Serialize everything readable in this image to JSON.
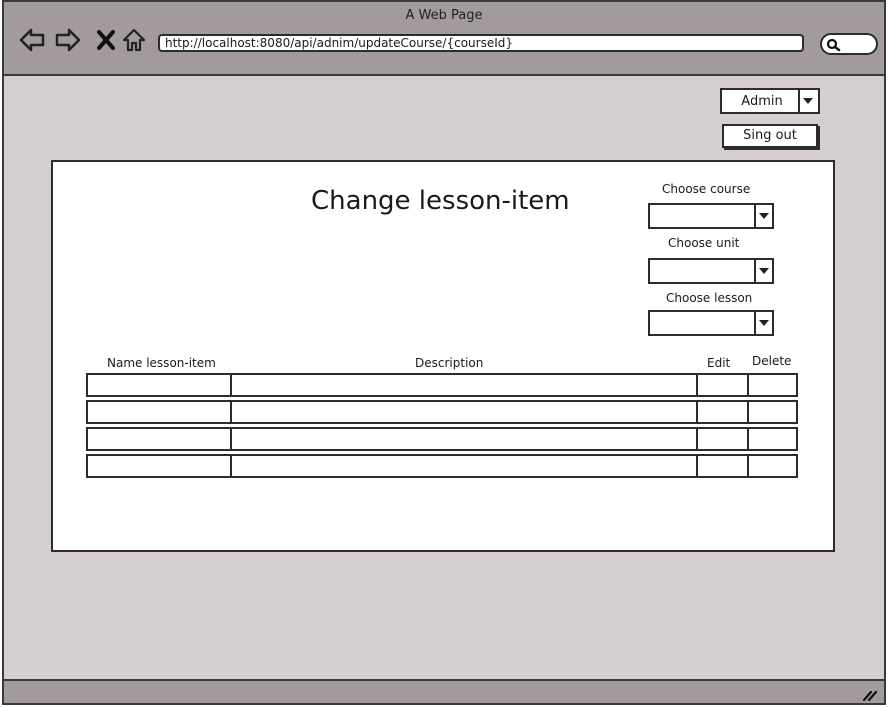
{
  "window": {
    "title": "A Web Page",
    "address": "http://localhost:8080/api/adnim/updateCourse/{courseId}"
  },
  "header": {
    "user_select_value": "Admin",
    "signout_label": "Sing out"
  },
  "main": {
    "heading": "Change lesson-item",
    "choosers": [
      {
        "label": "Choose course",
        "value": ""
      },
      {
        "label": "Choose unit",
        "value": ""
      },
      {
        "label": "Choose lesson",
        "value": ""
      }
    ],
    "table": {
      "columns": [
        "Name lesson-item",
        "Description",
        "Edit",
        "Delete"
      ],
      "rows": [
        [
          "",
          "",
          "",
          ""
        ],
        [
          "",
          "",
          "",
          ""
        ],
        [
          "",
          "",
          "",
          ""
        ],
        [
          "",
          "",
          "",
          ""
        ]
      ]
    }
  },
  "icons": [
    "back-icon",
    "forward-icon",
    "close-icon",
    "home-icon",
    "search-icon",
    "resize-grip-icon",
    "chevron-down-icon"
  ]
}
